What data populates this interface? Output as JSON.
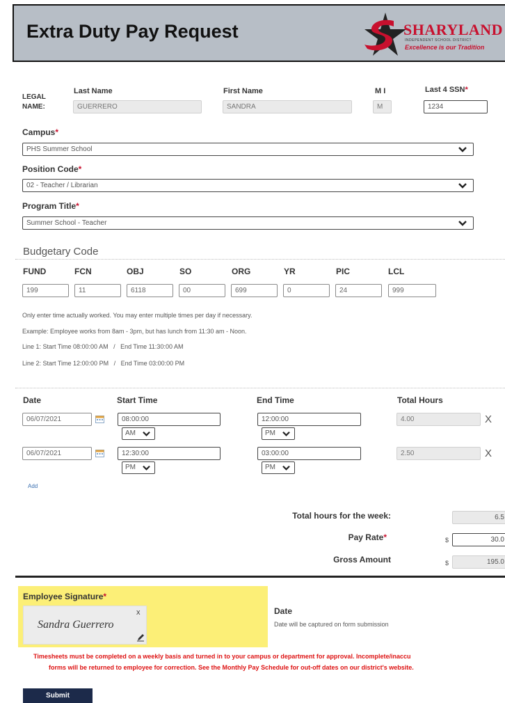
{
  "header": {
    "title": "Extra Duty Pay Request"
  },
  "logo": {
    "name": "SHARYLAND",
    "subtitle": "INDEPENDENT SCHOOL DISTRICT",
    "motto": "Excellence is our Tradition"
  },
  "legal": {
    "label_line1": "LEGAL",
    "label_line2": "NAME:",
    "last_name_label": "Last Name",
    "last_name": "GUERRERO",
    "first_name_label": "First Name",
    "first_name": "SANDRA",
    "mi_label": "M I",
    "mi": "M",
    "ssn_label": "Last 4 SSN",
    "ssn": "1234"
  },
  "required_mark": "*",
  "campus": {
    "label": "Campus",
    "value": "PHS Summer School"
  },
  "position": {
    "label": "Position Code",
    "value": "02 - Teacher / Librarian"
  },
  "program": {
    "label": "Program Title",
    "value": "Summer School - Teacher"
  },
  "budget": {
    "title": "Budgetary Code",
    "fields": [
      {
        "label": "FUND",
        "value": "199"
      },
      {
        "label": "FCN",
        "value": "11"
      },
      {
        "label": "OBJ",
        "value": "6118"
      },
      {
        "label": "SO",
        "value": "00"
      },
      {
        "label": "ORG",
        "value": "699"
      },
      {
        "label": "YR",
        "value": "0"
      },
      {
        "label": "PIC",
        "value": "24"
      },
      {
        "label": "LCL",
        "value": "999"
      }
    ]
  },
  "instructions": [
    "Only enter time actually worked.  You may enter multiple times per day if necessary.",
    "Example: Employee works from 8am - 3pm, but has lunch from 11:30 am - Noon.",
    "Line 1: Start Time 08:00:00 AM   /   End Time 11:30:00 AM",
    "Line 2: Start Time 12:00:00 PM   /   End Time 03:00:00 PM"
  ],
  "time_table": {
    "headers": {
      "date": "Date",
      "start": "Start Time",
      "end": "End Time",
      "total": "Total Hours"
    },
    "rows": [
      {
        "date": "06/07/2021",
        "start": "08:00:00",
        "start_ampm": "AM",
        "end": "12:00:00",
        "end_ampm": "PM",
        "total": "4.00"
      },
      {
        "date": "06/07/2021",
        "start": "12:30:00",
        "start_ampm": "PM",
        "end": "03:00:00",
        "end_ampm": "PM",
        "total": "2.50"
      }
    ],
    "remove_symbol": "X",
    "add_label": "Add"
  },
  "totals": {
    "week_label": "Total hours for the week:",
    "week_value": "6.5",
    "rate_label": "Pay Rate",
    "rate_value": "30.0",
    "gross_label": "Gross Amount",
    "gross_value": "195.0",
    "currency": "$"
  },
  "signature": {
    "label": "Employee Signature",
    "value": "Sandra Guerrero",
    "clear_symbol": "x"
  },
  "date_section": {
    "label": "Date",
    "note": "Date will be captured on form submission"
  },
  "warning": {
    "line1": "Timesheets must be completed on a weekly basis and turned in to your campus or department for approval. Incomplete/inaccu",
    "line2": "forms will be returned to employee for correction. See the Monthly Pay Schedule for out-off dates on our district's website."
  },
  "submit_label": "Submit",
  "colors": {
    "header_bg": "#b7bec6",
    "required": "#c8102e",
    "signature_bg": "#fcef77",
    "submit_bg": "#1c2a4a"
  }
}
